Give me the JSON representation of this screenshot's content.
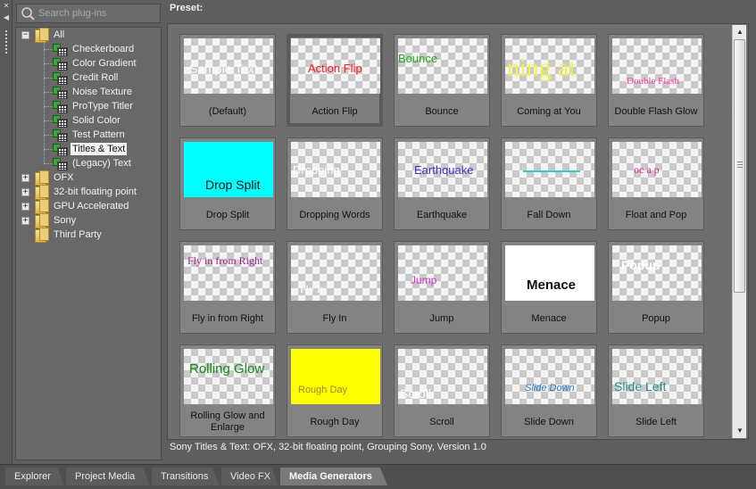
{
  "search": {
    "placeholder": "Search plug-ins"
  },
  "tree": {
    "items": [
      {
        "label": "All",
        "kind": "folder",
        "expanded": true
      },
      {
        "label": "Checkerboard",
        "kind": "plugin"
      },
      {
        "label": "Color Gradient",
        "kind": "plugin"
      },
      {
        "label": "Credit Roll",
        "kind": "plugin"
      },
      {
        "label": "Noise Texture",
        "kind": "plugin"
      },
      {
        "label": "ProType Titler",
        "kind": "plugin"
      },
      {
        "label": "Solid Color",
        "kind": "plugin"
      },
      {
        "label": "Test Pattern",
        "kind": "plugin"
      },
      {
        "label": "Titles & Text",
        "kind": "plugin",
        "selected": true
      },
      {
        "label": "(Legacy) Text",
        "kind": "plugin"
      },
      {
        "label": "OFX",
        "kind": "folder",
        "expanded": false
      },
      {
        "label": "32-bit floating point",
        "kind": "folder",
        "expanded": false
      },
      {
        "label": "GPU Accelerated",
        "kind": "folder",
        "expanded": false
      },
      {
        "label": "Sony",
        "kind": "folder",
        "expanded": false
      },
      {
        "label": "Third Party",
        "kind": "folder"
      }
    ]
  },
  "preset": {
    "header": "Preset:",
    "cards": [
      {
        "caption": "(Default)",
        "thumb_text": "Sample Text",
        "text_color": "#ffffff",
        "font": "sans"
      },
      {
        "caption": "Action Flip",
        "thumb_text": "Action Flip",
        "text_color": "#ff1a1a",
        "font": "sans",
        "selected": true
      },
      {
        "caption": "Bounce",
        "thumb_text": "Bounce",
        "text_color": "#22aa22",
        "font": "sans"
      },
      {
        "caption": "Coming at You",
        "thumb_text": "ning at",
        "text_color": "#f2f24a",
        "font": "serif"
      },
      {
        "caption": "Double Flash Glow",
        "thumb_text": "Double Flash",
        "text_color": "#ff3fa0",
        "font": "serif"
      },
      {
        "caption": "Drop Split",
        "thumb_text": "Drop Split",
        "text_color": "#111111",
        "font": "sans",
        "bg": "#00ffff"
      },
      {
        "caption": "Dropping Words",
        "thumb_text": "Dropping",
        "text_color": "#ffffff",
        "font": "sans"
      },
      {
        "caption": "Earthquake",
        "thumb_text": "Earthquake",
        "text_color": "#3a3acc",
        "font": "sans"
      },
      {
        "caption": "Fall Down",
        "thumb_text": "",
        "text_color": "#33cccc",
        "font": "sans"
      },
      {
        "caption": "Float and Pop",
        "thumb_text": "oc a p",
        "text_color": "#e0207a",
        "font": "serif"
      },
      {
        "caption": "Fly in from Right",
        "thumb_text": "Fly in from Right",
        "text_color": "#992288",
        "font": "serif"
      },
      {
        "caption": "Fly In",
        "thumb_text": "Fly In",
        "text_color": "#ffffff",
        "font": "serif"
      },
      {
        "caption": "Jump",
        "thumb_text": "Jump",
        "text_color": "#cc33cc",
        "font": "sans"
      },
      {
        "caption": "Menace",
        "thumb_text": "Menace",
        "text_color": "#111111",
        "font": "sans",
        "bg": "#ffffff"
      },
      {
        "caption": "Popup",
        "thumb_text": "Popup",
        "text_color": "#ffffff",
        "font": "sans"
      },
      {
        "caption": "Rolling Glow and Enlarge",
        "thumb_text": "Rolling Glow",
        "text_color": "#1a8a1a",
        "font": "sans"
      },
      {
        "caption": "Rough Day",
        "thumb_text": "Rough Day",
        "text_color": "#9a8a2a",
        "font": "sans",
        "bg": "#ffff00"
      },
      {
        "caption": "Scroll",
        "thumb_text": "Scroll",
        "text_color": "#ffffff",
        "font": "sans"
      },
      {
        "caption": "Slide Down",
        "thumb_text": "Slide Down",
        "text_color": "#2a7acc",
        "font": "sans"
      },
      {
        "caption": "Slide Left",
        "thumb_text": "Slide Left",
        "text_color": "#2a8a8a",
        "font": "sans"
      }
    ]
  },
  "status": "Sony Titles & Text: OFX, 32-bit floating point, Grouping Sony, Version 1.0",
  "tabs": [
    {
      "label": "Explorer"
    },
    {
      "label": "Project Media"
    },
    {
      "label": "Transitions"
    },
    {
      "label": "Video FX"
    },
    {
      "label": "Media Generators",
      "active": true
    }
  ]
}
